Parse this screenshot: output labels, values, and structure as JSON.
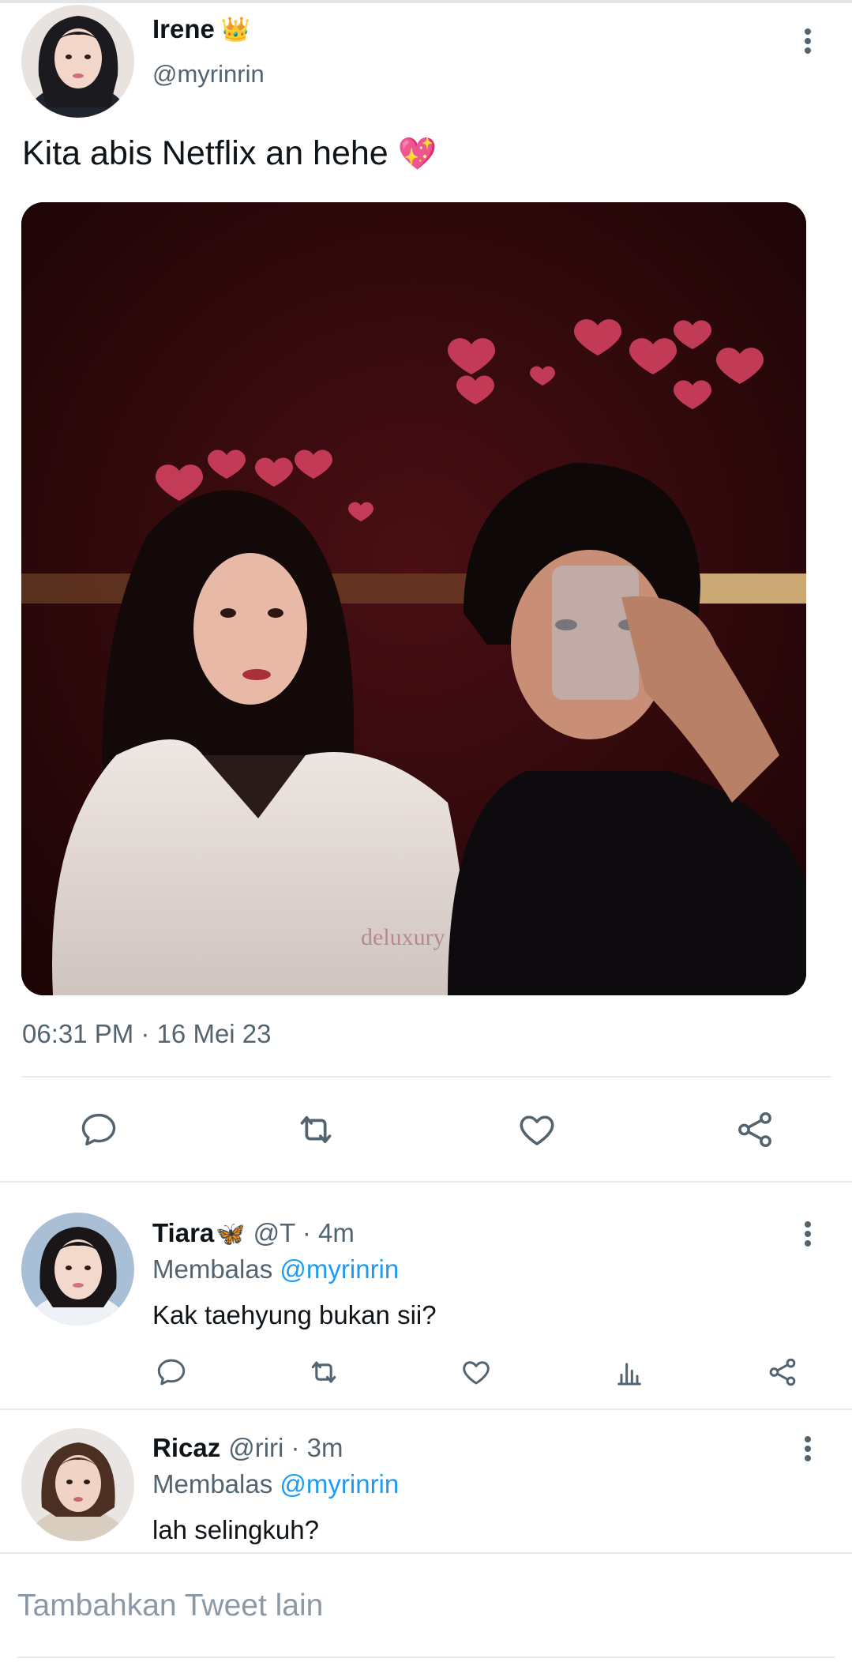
{
  "main_tweet": {
    "author_name": "Irene",
    "crown": "👑",
    "handle": "@myrinrin",
    "text": "Kita abis Netflix an hehe",
    "text_emoji": "💖",
    "timestamp": "06:31 PM · 16 Mei 23",
    "watermark": "deluxury",
    "actions": [
      "reply-icon",
      "retweet-icon",
      "like-icon",
      "share-icon"
    ]
  },
  "replies": [
    {
      "name": "Tiara",
      "emoji": "🦋",
      "meta": "@T · 4m",
      "reply_prefix": "Membalas",
      "reply_mention": "@myrinrin",
      "text": "Kak taehyung bukan sii?"
    },
    {
      "name": "Ricaz",
      "meta": "@riri · 3m",
      "reply_prefix": "Membalas",
      "reply_mention": "@myrinrin",
      "text": "lah selingkuh?"
    }
  ],
  "compose": {
    "placeholder": "Tambahkan Tweet lain"
  },
  "colors": {
    "text": "#0f1419",
    "secondary": "#536471",
    "accent": "#1d9bf0",
    "divider": "#e6e9eb"
  }
}
